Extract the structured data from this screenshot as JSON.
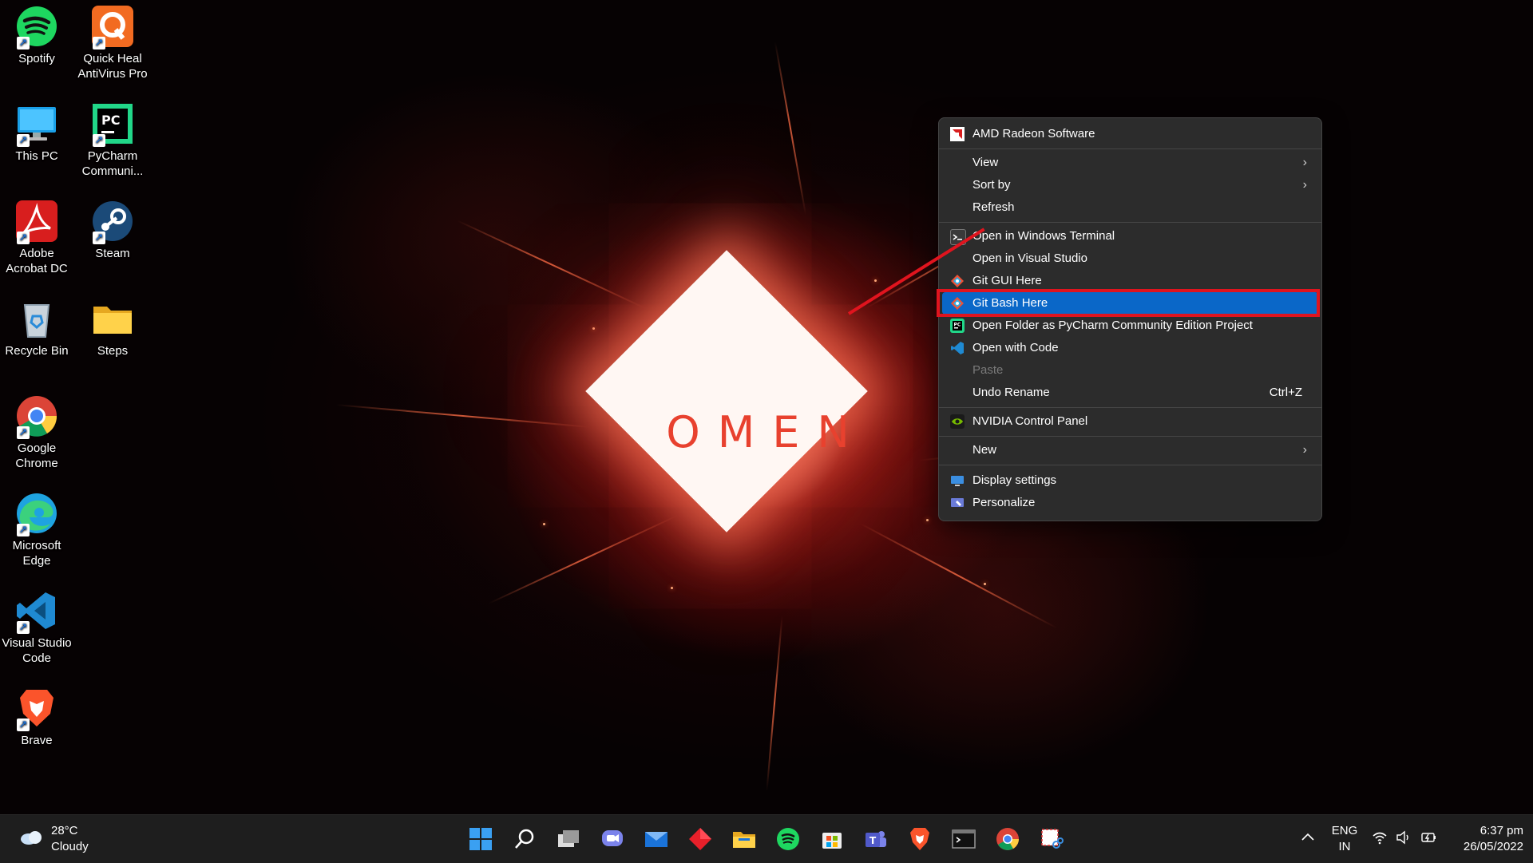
{
  "desktop": {
    "icons": [
      {
        "label": "Spotify",
        "icon": "spotify-icon"
      },
      {
        "label": "Quick Heal AntiVirus Pro",
        "icon": "quick-heal-icon"
      },
      {
        "label": "This PC",
        "icon": "this-pc-icon"
      },
      {
        "label": "PyCharm Communi...",
        "icon": "pycharm-icon"
      },
      {
        "label": "Adobe Acrobat DC",
        "icon": "adobe-acrobat-icon"
      },
      {
        "label": "Steam",
        "icon": "steam-icon"
      },
      {
        "label": "Recycle Bin",
        "icon": "recycle-bin-icon"
      },
      {
        "label": "Steps",
        "icon": "folder-icon"
      },
      {
        "label": "Google Chrome",
        "icon": "chrome-icon"
      },
      {
        "label": "Microsoft Edge",
        "icon": "edge-icon"
      },
      {
        "label": "Visual Studio Code",
        "icon": "vscode-icon"
      },
      {
        "label": "Brave",
        "icon": "brave-icon"
      }
    ],
    "wallpaper_logo": "OMEN"
  },
  "context_menu": {
    "items": [
      {
        "label": "AMD Radeon Software",
        "icon": "amd-radeon-icon"
      },
      {
        "label": "View",
        "submenu": true
      },
      {
        "label": "Sort by",
        "submenu": true
      },
      {
        "label": "Refresh"
      },
      {
        "label": "Open in Windows Terminal",
        "icon": "terminal-icon"
      },
      {
        "label": "Open in Visual Studio"
      },
      {
        "label": "Git GUI Here",
        "icon": "git-icon"
      },
      {
        "label": "Git Bash Here",
        "icon": "git-icon",
        "highlighted": true
      },
      {
        "label": "Open Folder as PyCharm Community Edition Project",
        "icon": "pycharm-icon"
      },
      {
        "label": "Open with Code",
        "icon": "vscode-icon"
      },
      {
        "label": "Paste",
        "disabled": true
      },
      {
        "label": "Undo Rename",
        "shortcut": "Ctrl+Z"
      },
      {
        "label": "NVIDIA Control Panel",
        "icon": "nvidia-icon"
      },
      {
        "label": "New",
        "submenu": true
      },
      {
        "label": "Display settings",
        "icon": "display-icon"
      },
      {
        "label": "Personalize",
        "icon": "personalize-icon"
      }
    ],
    "highlight_color": "#0a67c8",
    "annotation_color": "#e0141e"
  },
  "taskbar": {
    "weather": {
      "temp": "28°C",
      "condition": "Cloudy"
    },
    "pinned": [
      "start-icon",
      "search-icon",
      "task-view-icon",
      "chat-icon",
      "mail-icon",
      "red-diamond-app-icon",
      "file-explorer-icon",
      "spotify-icon",
      "store-icon",
      "teams-icon",
      "brave-icon",
      "terminal-icon",
      "chrome-icon",
      "snipping-tool-icon"
    ],
    "tray": {
      "language_line1": "ENG",
      "language_line2": "IN",
      "time": "6:37 pm",
      "date": "26/05/2022"
    }
  }
}
